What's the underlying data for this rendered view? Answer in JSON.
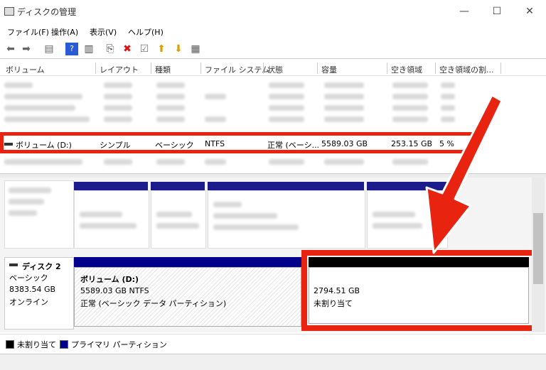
{
  "window": {
    "title": "ディスクの管理",
    "minimize": "—",
    "maximize": "☐",
    "close": "✕"
  },
  "menu": [
    "ファイル(F)",
    "操作(A)",
    "表示(V)",
    "ヘルプ(H)"
  ],
  "toolbar": {
    "icons": [
      "back-arrow-icon",
      "forward-arrow-icon",
      "console-icon",
      "help-icon",
      "properties-icon",
      "connect-icon",
      "delete-icon",
      "check-icon",
      "export-icon",
      "import-icon",
      "view-icon"
    ]
  },
  "columns": [
    "ボリューム",
    "レイアウト",
    "種類",
    "ファイル システム",
    "状態",
    "容量",
    "空き領域",
    "空き領域の割..."
  ],
  "selected_volume": {
    "name": "ボリューム (D:)",
    "layout": "シンプル",
    "type": "ベーシック",
    "fs": "NTFS",
    "status": "正常 (ベーシ...",
    "capacity": "5589.03 GB",
    "free": "253.15 GB",
    "free_pct": "5 %"
  },
  "disk2": {
    "label": "ディスク 2",
    "type": "ベーシック",
    "size": "8383.54 GB",
    "state": "オンライン"
  },
  "volume_d": {
    "name": "ボリューム (D:)",
    "size_fs": "5589.03 GB NTFS",
    "status": "正常 (ベーシック データ パーティション)"
  },
  "unallocated": {
    "size": "2794.51 GB",
    "label": "未割り当て"
  },
  "legend": {
    "unallocated": "未割り当て",
    "primary": "プライマリ パーティション"
  },
  "colors": {
    "highlight": "#e8230f",
    "primary": "#00008b",
    "unallocated": "#000000"
  }
}
